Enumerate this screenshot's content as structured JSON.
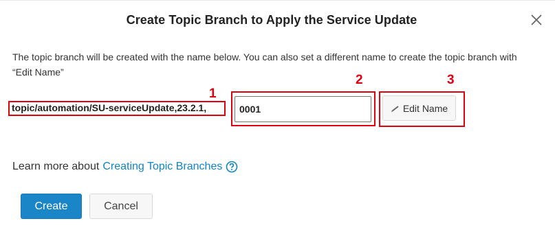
{
  "dialog": {
    "title": "Create Topic Branch to Apply the Service Update",
    "close_icon": "close-icon",
    "description": "The topic branch will be created with the name below. You can also set a different name to create the topic branch with “Edit Name”"
  },
  "branch": {
    "prefix": "topic/automation/SU-serviceUpdate,23.2.1,",
    "suffix_value": "0001",
    "edit_label": "Edit Name",
    "edit_icon": "pencil-icon"
  },
  "annotations": {
    "marker_1": "1",
    "marker_2": "2",
    "marker_3": "3",
    "color": "#e0000f"
  },
  "learn_more": {
    "text": "Learn more about",
    "link": "Creating Topic Branches",
    "icon": "help-circle-icon"
  },
  "actions": {
    "create_label": "Create",
    "cancel_label": "Cancel"
  },
  "colors": {
    "primary": "#1a85c7",
    "link": "#0f84c8"
  }
}
